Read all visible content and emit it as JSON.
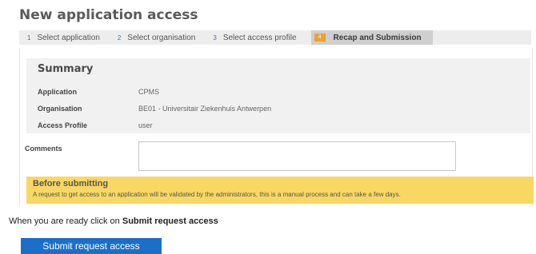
{
  "page": {
    "title": "New application access"
  },
  "steps": [
    {
      "number": "1",
      "label": "Select application"
    },
    {
      "number": "2",
      "label": "Select organisation"
    },
    {
      "number": "3",
      "label": "Select access profile"
    },
    {
      "number": "4",
      "label": "Recap and Submission",
      "active": true
    }
  ],
  "summary": {
    "title": "Summary",
    "rows": [
      {
        "key": "Application",
        "value": "CPMS"
      },
      {
        "key": "Organisation",
        "value": "BE01 - Universitair Ziekenhuis Antwerpen"
      },
      {
        "key": "Access Profile",
        "value": "user"
      }
    ]
  },
  "comments": {
    "label": "Comments",
    "value": ""
  },
  "notice": {
    "title": "Before submitting",
    "text": "A request to get access to an application will be validated by the administrators, this is a manual process and can take a few days."
  },
  "ready": {
    "prefix": "When you are ready click on ",
    "action": "Submit request access"
  },
  "submit": {
    "label": "Submit request access"
  },
  "colors": {
    "accent": "#1c6fc7",
    "notice_bg": "#f8d863",
    "active_step": "#f0a030"
  }
}
